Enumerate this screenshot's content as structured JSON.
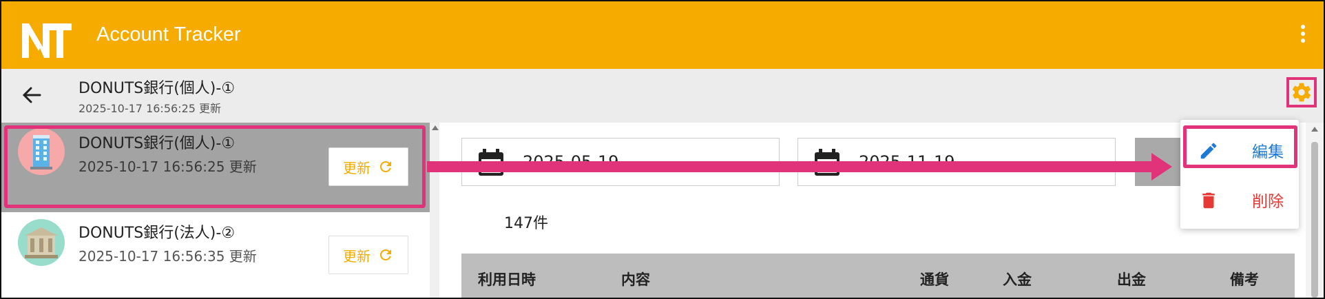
{
  "app": {
    "title": "Account Tracker",
    "brand_color": "#f5ab00"
  },
  "subheader": {
    "title": "DONUTS銀行(個人)-①",
    "updated": "2025-10-17 16:56:25 更新"
  },
  "accounts": [
    {
      "name": "DONUTS銀行(個人)-①",
      "updated": "2025-10-17 16:56:25 更新",
      "refresh_label": "更新",
      "icon": "office-building-icon",
      "selected": true
    },
    {
      "name": "DONUTS銀行(法人)-②",
      "updated": "2025-10-17 16:56:35 更新",
      "refresh_label": "更新",
      "icon": "bank-building-icon",
      "selected": false
    }
  ],
  "filters": {
    "start_date": "2025-05-19",
    "end_date": "2025-11-19"
  },
  "count_label": "147件",
  "table": {
    "headers": [
      "利用日時",
      "内容",
      "通貨",
      "入金",
      "出金",
      "備考"
    ]
  },
  "menu": {
    "items": [
      {
        "label": "編集",
        "icon": "pencil-icon",
        "color": "#1e7ad4"
      },
      {
        "label": "削除",
        "icon": "trash-icon",
        "color": "#e53935"
      }
    ]
  },
  "annotation_color": "#e0337a"
}
